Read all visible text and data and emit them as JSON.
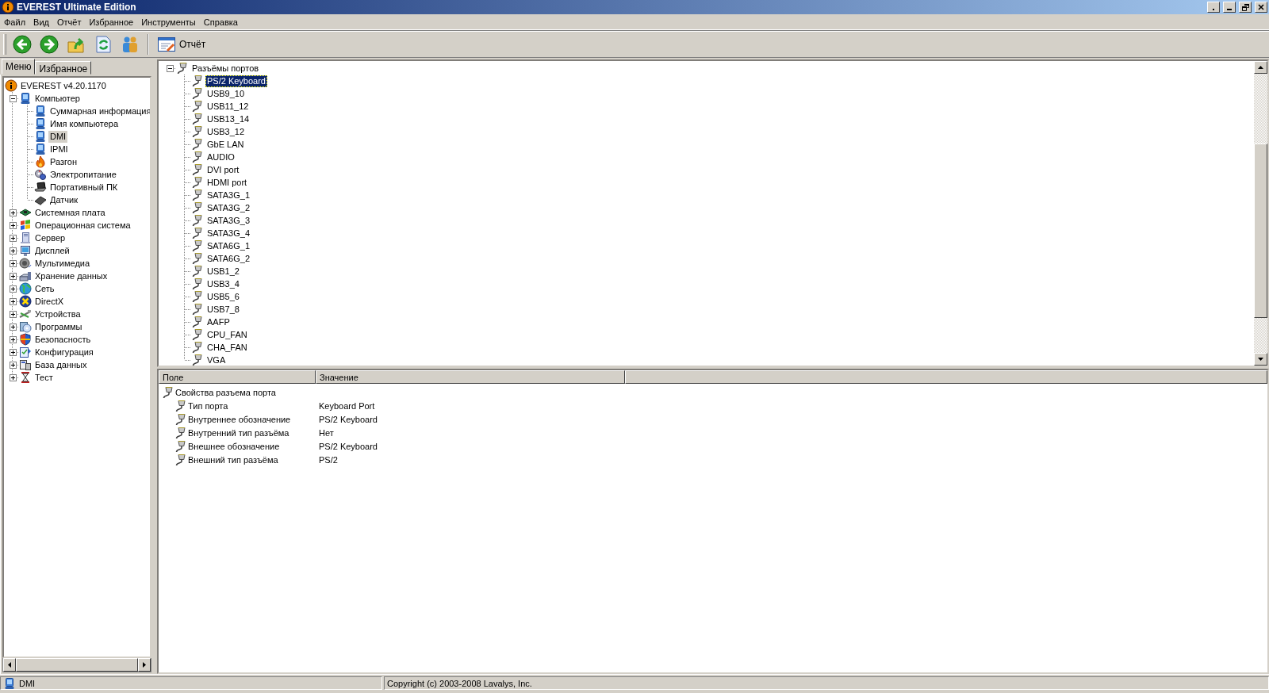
{
  "window": {
    "title": "EVEREST Ultimate Edition"
  },
  "menu": [
    "Файл",
    "Вид",
    "Отчёт",
    "Избранное",
    "Инструменты",
    "Справка"
  ],
  "toolbar": [
    {
      "kind": "back"
    },
    {
      "kind": "forward"
    },
    {
      "kind": "up"
    },
    {
      "kind": "refresh"
    },
    {
      "kind": "users"
    },
    {
      "kind": "report",
      "label": "Отчёт"
    }
  ],
  "sidebar": {
    "tabs": [
      {
        "label": "Меню",
        "selected": true
      },
      {
        "label": "Избранное",
        "selected": false
      }
    ],
    "tree": [
      {
        "label": "EVEREST v4.20.1170",
        "kind": "info",
        "selected": false,
        "children": [
          {
            "label": "Компьютер",
            "kind": "computer",
            "selected": false,
            "expanded": true,
            "children": [
              {
                "label": "Суммарная информация",
                "kind": "computer",
                "selected": false
              },
              {
                "label": "Имя компьютера",
                "kind": "computer",
                "selected": false
              },
              {
                "label": "DMI",
                "kind": "computer",
                "selected": true
              },
              {
                "label": "IPMI",
                "kind": "computer",
                "selected": false
              },
              {
                "label": "Разгон",
                "kind": "flame",
                "selected": false
              },
              {
                "label": "Электропитание",
                "kind": "power",
                "selected": false
              },
              {
                "label": "Портативный ПК",
                "kind": "laptop",
                "selected": false
              },
              {
                "label": "Датчик",
                "kind": "chip",
                "selected": false
              }
            ]
          },
          {
            "label": "Системная плата",
            "kind": "board",
            "selected": false,
            "expanded": false
          },
          {
            "label": "Операционная система",
            "kind": "flag",
            "selected": false,
            "expanded": false
          },
          {
            "label": "Сервер",
            "kind": "server",
            "selected": false,
            "expanded": false
          },
          {
            "label": "Дисплей",
            "kind": "display",
            "selected": false,
            "expanded": false
          },
          {
            "label": "Мультимедиа",
            "kind": "speaker",
            "selected": false,
            "expanded": false
          },
          {
            "label": "Хранение данных",
            "kind": "drive",
            "selected": false,
            "expanded": false
          },
          {
            "label": "Сеть",
            "kind": "globe",
            "selected": false,
            "expanded": false
          },
          {
            "label": "DirectX",
            "kind": "xcircle",
            "selected": false,
            "expanded": false
          },
          {
            "label": "Устройства",
            "kind": "cable",
            "selected": false,
            "expanded": false
          },
          {
            "label": "Программы",
            "kind": "disc",
            "selected": false,
            "expanded": false
          },
          {
            "label": "Безопасность",
            "kind": "shield",
            "selected": false,
            "expanded": false
          },
          {
            "label": "Конфигурация",
            "kind": "checklist",
            "selected": false,
            "expanded": false
          },
          {
            "label": "База данных",
            "kind": "database",
            "selected": false,
            "expanded": false
          },
          {
            "label": "Тест",
            "kind": "hourglass",
            "selected": false,
            "expanded": false
          }
        ]
      }
    ]
  },
  "ports_tree": [
    {
      "label": "Разъёмы портов",
      "kind": "port",
      "selected": false,
      "expanded": true,
      "children": [
        {
          "label": "PS/2 Keyboard",
          "kind": "port",
          "selected": true
        },
        {
          "label": "USB9_10",
          "kind": "port",
          "selected": false
        },
        {
          "label": "USB11_12",
          "kind": "port",
          "selected": false
        },
        {
          "label": "USB13_14",
          "kind": "port",
          "selected": false
        },
        {
          "label": "USB3_12",
          "kind": "port",
          "selected": false
        },
        {
          "label": "GbE LAN",
          "kind": "port",
          "selected": false
        },
        {
          "label": "AUDIO",
          "kind": "port",
          "selected": false
        },
        {
          "label": "DVI port",
          "kind": "port",
          "selected": false
        },
        {
          "label": "HDMI port",
          "kind": "port",
          "selected": false
        },
        {
          "label": "SATA3G_1",
          "kind": "port",
          "selected": false
        },
        {
          "label": "SATA3G_2",
          "kind": "port",
          "selected": false
        },
        {
          "label": "SATA3G_3",
          "kind": "port",
          "selected": false
        },
        {
          "label": "SATA3G_4",
          "kind": "port",
          "selected": false
        },
        {
          "label": "SATA6G_1",
          "kind": "port",
          "selected": false
        },
        {
          "label": "SATA6G_2",
          "kind": "port",
          "selected": false
        },
        {
          "label": "USB1_2",
          "kind": "port",
          "selected": false
        },
        {
          "label": "USB3_4",
          "kind": "port",
          "selected": false
        },
        {
          "label": "USB5_6",
          "kind": "port",
          "selected": false
        },
        {
          "label": "USB7_8",
          "kind": "port",
          "selected": false
        },
        {
          "label": "AAFP",
          "kind": "port",
          "selected": false
        },
        {
          "label": "CPU_FAN",
          "kind": "port",
          "selected": false
        },
        {
          "label": "CHA_FAN",
          "kind": "port",
          "selected": false
        },
        {
          "label": "VGA",
          "kind": "port",
          "selected": false
        }
      ]
    }
  ],
  "details": {
    "columns": [
      "Поле",
      "Значение"
    ],
    "rows": [
      {
        "kind": "group",
        "field": "Свойства разъема порта",
        "children": [
          {
            "kind": "field",
            "field": "Тип порта",
            "value": "Keyboard Port"
          },
          {
            "kind": "field",
            "field": "Внутреннее обозначение",
            "value": "PS/2 Keyboard"
          },
          {
            "kind": "field",
            "field": "Внутренний тип разъёма",
            "value": "Нет"
          },
          {
            "kind": "field",
            "field": "Внешнее обозначение",
            "value": "PS/2 Keyboard"
          },
          {
            "kind": "field",
            "field": "Внешний тип разъёма",
            "value": "PS/2"
          }
        ]
      }
    ]
  },
  "status_bar": [
    {
      "kind": "computer",
      "text": "DMI"
    },
    {
      "text": "Copyright (c) 2003-2008 Lavalys, Inc."
    }
  ]
}
